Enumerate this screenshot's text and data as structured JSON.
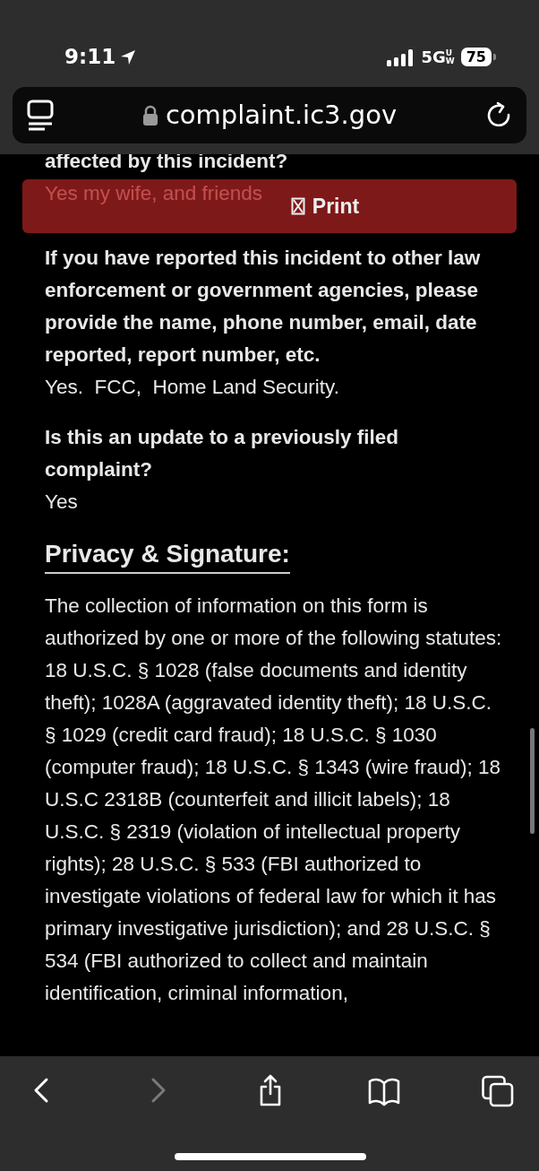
{
  "status_bar": {
    "time": "9:11",
    "network": "5G",
    "network_badge": "UW",
    "battery": "75"
  },
  "address_bar": {
    "url": "complaint.ic3.gov"
  },
  "print_button": {
    "label": "Print"
  },
  "qa": [
    {
      "question": "affected by this incident?",
      "answer": "Yes my wife, and friends"
    },
    {
      "question": "If you have reported this incident to other law enforcement or government agencies, please provide the name, phone number, email, date reported, report number, etc.",
      "answer": "Yes.  FCC,  Home Land Security."
    },
    {
      "question": "Is this an update to a previously filed complaint?",
      "answer": "Yes"
    }
  ],
  "section": {
    "heading": "Privacy & Signature:",
    "paragraph": "The collection of information on this form is authorized by one or more of the following statutes: 18 U.S.C. § 1028 (false documents and identity theft); 1028A (aggravated identity theft); 18 U.S.C. § 1029 (credit card fraud); 18 U.S.C. § 1030 (computer fraud); 18 U.S.C. § 1343 (wire fraud); 18 U.S.C 2318B (counterfeit and illicit labels); 18 U.S.C. § 2319 (violation of intellectual property rights); 28 U.S.C. § 533 (FBI authorized to investigate violations of federal law for which it has primary investigative jurisdiction); and 28 U.S.C. § 534 (FBI authorized to collect and maintain identification, criminal information,"
  },
  "toolbar": {
    "buttons": [
      {
        "kind": "back",
        "disabled": false
      },
      {
        "kind": "forward",
        "disabled": true
      },
      {
        "kind": "share",
        "disabled": false
      },
      {
        "kind": "bookmarks",
        "disabled": false
      },
      {
        "kind": "tabs",
        "disabled": false
      }
    ]
  }
}
